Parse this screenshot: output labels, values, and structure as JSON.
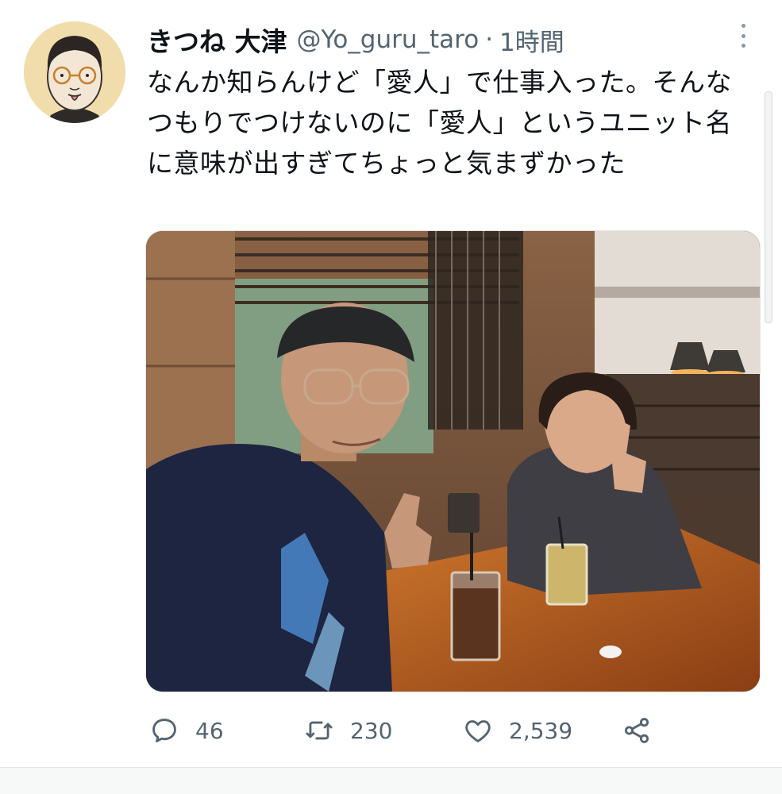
{
  "tweet": {
    "display_name": "きつね 大津",
    "handle": "@Yo_guru_taro",
    "separator": "·",
    "time": "1時間",
    "text": "なんか知らんけど「愛人」で仕事入った。そんなつもりでつけないのに「愛人」というユニット名に意味が出すぎてちょっと気まずかった"
  },
  "actions": {
    "reply_count": "46",
    "retweet_count": "230",
    "like_count": "2,539"
  },
  "icons": {
    "reply": "speech-bubble-icon",
    "retweet": "retweet-arrows-icon",
    "like": "heart-icon",
    "share": "share-nodes-icon",
    "more": "vertical-dots-icon"
  },
  "colors": {
    "text_primary": "#0f1419",
    "text_secondary": "#536471",
    "avatar_background": "#f1ddab"
  }
}
